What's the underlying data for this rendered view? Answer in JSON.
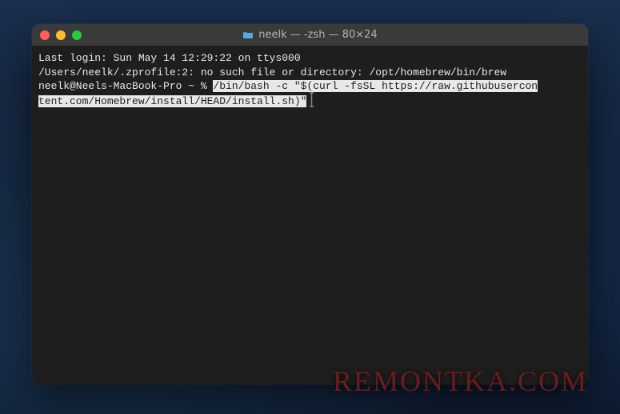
{
  "window": {
    "title": "neelk — -zsh — 80×24"
  },
  "terminal": {
    "line1": "Last login: Sun May 14 12:29:22 on ttys000",
    "line2": "/Users/neelk/.zprofile:2: no such file or directory: /opt/homebrew/bin/brew",
    "prompt": "neelk@Neels-MacBook-Pro ~ % ",
    "command_part1": "/bin/bash -c \"$(curl -fsSL https://raw.githubusercon",
    "command_part2": "tent.com/Homebrew/install/HEAD/install.sh)\""
  },
  "watermark": "REMONTKA.COM"
}
